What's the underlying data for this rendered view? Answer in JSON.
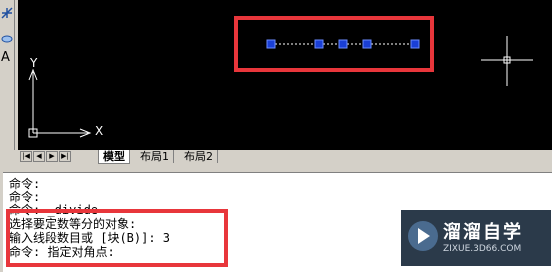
{
  "left_toolbar": {
    "icons": [
      "draw-icon",
      "view-icon"
    ],
    "letter": "A"
  },
  "canvas": {
    "ucs_labels": {
      "y": "Y",
      "x": "X"
    },
    "colors": {
      "background": "#000000",
      "line": "#ffffff",
      "node": "#1a3fd6",
      "highlight": "#e8363b"
    }
  },
  "tabs": {
    "nav": [
      "|◀",
      "◀",
      "▶",
      "▶|"
    ],
    "items": [
      {
        "label": "模型",
        "active": true
      },
      {
        "label": "布局1",
        "active": false
      },
      {
        "label": "布局2",
        "active": false
      }
    ]
  },
  "command_window": {
    "lines": [
      "命令:",
      "命令:",
      "命令: _divide",
      "选择要定数等分的对象:",
      "输入线段数目或 [块(B)]: 3",
      "命令: 指定对角点:"
    ]
  },
  "watermark": {
    "title": "溜溜自学",
    "subtitle": "ZIXUE.3D66.COM"
  }
}
